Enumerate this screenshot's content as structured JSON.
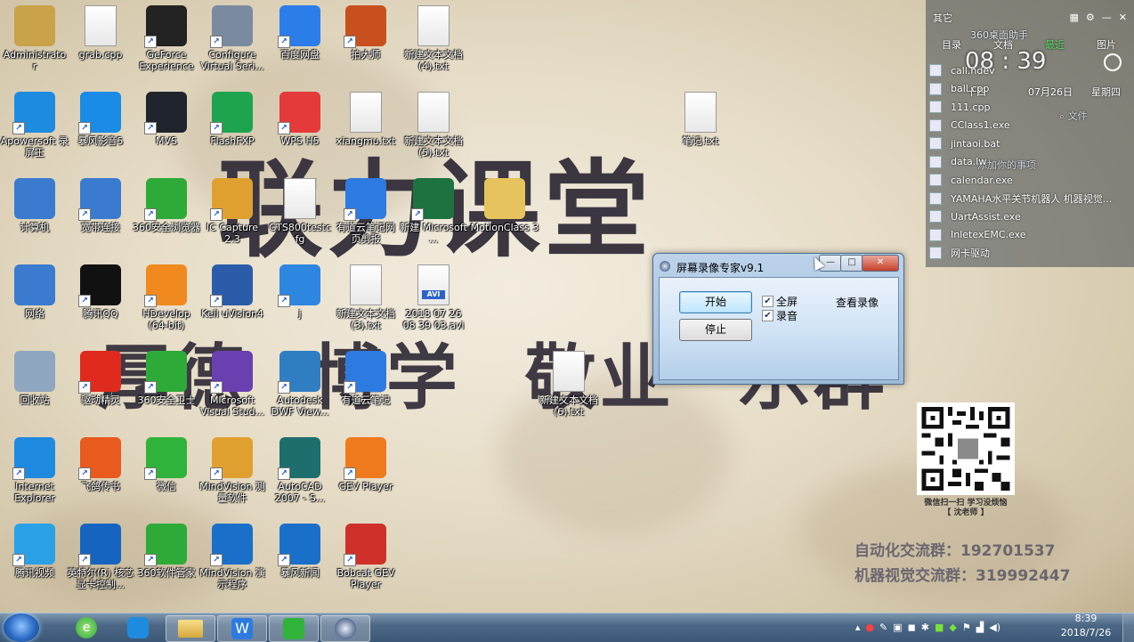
{
  "wallpaper": {
    "title_text": "联力课堂",
    "motto_text": "厚德 博学 敬业 乐群",
    "ad_line1": "自动化交流群：192701537",
    "ad_line2": "机器视觉交流群：319992447",
    "qr_caption_line1": "微信扫一扫 学习没烦恼",
    "qr_caption_line2": "【 沈老师 】"
  },
  "desktop_icons": [
    {
      "label": "Administrato r",
      "icon": "user-folder-icon",
      "color": "#c9a24a"
    },
    {
      "label": "grab.cpp",
      "icon": "cpp-file-icon",
      "color": "#ffffff"
    },
    {
      "label": "GeForce Experience",
      "icon": "nvidia-icon",
      "color": "#222222"
    },
    {
      "label": "Configure Virtual Seri...",
      "icon": "serial-port-icon",
      "color": "#7a8aa0"
    },
    {
      "label": "百度网盘",
      "icon": "cloud-icon",
      "color": "#2b7de9"
    },
    {
      "label": "拍大师",
      "icon": "camera-icon",
      "color": "#c8501e"
    },
    {
      "label": "新建文本文档 (4).txt",
      "icon": "text-file-icon",
      "color": "#ffffff"
    },
    {
      "label": "Apowersoft 录屏王",
      "icon": "apowersoft-icon",
      "color": "#1d8ce0"
    },
    {
      "label": "暴风影音5",
      "icon": "storm-player-icon",
      "color": "#1a8be6"
    },
    {
      "label": "MVS",
      "icon": "mvs-icon",
      "color": "#20252d"
    },
    {
      "label": "FlashFXP",
      "icon": "flashfxp-icon",
      "color": "#1ea44e"
    },
    {
      "label": "WPS H5",
      "icon": "wps-icon",
      "color": "#e43a3a"
    },
    {
      "label": "xiangmu.txt",
      "icon": "text-file-icon",
      "color": "#ffffff"
    },
    {
      "label": "新建文本文档 (5).txt",
      "icon": "text-file-icon",
      "color": "#ffffff"
    },
    {
      "label": "笔记.txt",
      "icon": "text-file-icon",
      "color": "#ffffff"
    },
    {
      "label": "计算机",
      "icon": "computer-icon",
      "color": "#3a7bd0"
    },
    {
      "label": "宽带连接",
      "icon": "network-connection-icon",
      "color": "#3a7bd0"
    },
    {
      "label": "360安全浏览器",
      "icon": "browser-360-icon",
      "color": "#2eaa39"
    },
    {
      "label": "IC Capture 2.3",
      "icon": "ic-capture-icon",
      "color": "#e0a030"
    },
    {
      "label": "GTS800testc fg",
      "icon": "config-file-icon",
      "color": "#ffffff"
    },
    {
      "label": "有道云笔记网 页剪报",
      "icon": "youdao-clip-icon",
      "color": "#2d7be0"
    },
    {
      "label": "新建 Microsoft ...",
      "icon": "excel-icon",
      "color": "#1d7340"
    },
    {
      "label": "MotionClass 3",
      "icon": "folder-icon",
      "color": "#e6c35c"
    },
    {
      "label": "网络",
      "icon": "network-icon",
      "color": "#3a7bd0"
    },
    {
      "label": "腾讯QQ",
      "icon": "qq-icon",
      "color": "#111111"
    },
    {
      "label": "HDevelop (64-bit)",
      "icon": "halcon-icon",
      "color": "#f08a1e"
    },
    {
      "label": "Keil uVision4",
      "icon": "keil-icon",
      "color": "#2a5caa"
    },
    {
      "label": "j",
      "icon": "app-j-icon",
      "color": "#2d86e0"
    },
    {
      "label": "新建文本文档 (3).txt",
      "icon": "text-file-icon",
      "color": "#ffffff"
    },
    {
      "label": "2018 07 26 08 39 03.avi",
      "icon": "avi-file-icon",
      "color": "#ffffff"
    },
    {
      "label": "回收站",
      "icon": "recycle-bin-icon",
      "color": "#8fa7c0"
    },
    {
      "label": "驱动精灵",
      "icon": "driver-genius-icon",
      "color": "#e02a1e"
    },
    {
      "label": "360安全卫士",
      "icon": "security-360-icon",
      "color": "#2eaa39"
    },
    {
      "label": "Microsoft Visual Stud...",
      "icon": "visual-studio-icon",
      "color": "#6a3fb0"
    },
    {
      "label": "Autodesk DWF View...",
      "icon": "autodesk-icon",
      "color": "#2f7ec2"
    },
    {
      "label": "有道云笔记",
      "icon": "youdao-note-icon",
      "color": "#2d7be0"
    },
    {
      "label": "新建文本文档 (6).txt",
      "icon": "text-file-icon",
      "color": "#ffffff"
    },
    {
      "label": "Internet Explorer",
      "icon": "ie-icon",
      "color": "#1e8ae0"
    },
    {
      "label": "飞鸽传书",
      "icon": "feige-icon",
      "color": "#e85a1e"
    },
    {
      "label": "微信",
      "icon": "wechat-icon",
      "color": "#2fb33a"
    },
    {
      "label": "MindVision 测量软件",
      "icon": "mindvision-measure-icon",
      "color": "#e0a030"
    },
    {
      "label": "AutoCAD 2007 - S...",
      "icon": "autocad-icon",
      "color": "#1e6e6e"
    },
    {
      "label": "GEV Player",
      "icon": "gev-icon",
      "color": "#f07a1e"
    },
    {
      "label": "腾讯视频",
      "icon": "tencent-video-icon",
      "color": "#2aa0e6"
    },
    {
      "label": "英特尔(R) 核芯显卡控制...",
      "icon": "intel-icon",
      "color": "#1565c0"
    },
    {
      "label": "360软件管家",
      "icon": "software-manager-icon",
      "color": "#2eaa39"
    },
    {
      "label": "MindVision 演示程序",
      "icon": "mindvision-demo-icon",
      "color": "#1a6fc9"
    },
    {
      "label": "暴风新闻",
      "icon": "news-icon",
      "color": "#1a6fc9"
    },
    {
      "label": "Bobcat GEV Player",
      "icon": "bobcat-icon",
      "color": "#d0302a"
    }
  ],
  "side_panel": {
    "top_label": "其它",
    "tabs": [
      "目录",
      "文档",
      "最近",
      "图片"
    ],
    "helper_text": "360桌面助手",
    "clock": "08 : 39",
    "weekday_cn": "十四",
    "date": "07月26日",
    "weekday": "星期四",
    "files": [
      "call.hdev",
      "ball.cpp",
      "111.cpp",
      "CClass1.exe",
      "jintaoi.bat",
      "data.lw",
      "calendar.exe",
      "YAMAHA水平关节机器人 机器视觉...",
      "UartAssist.exe",
      "InletexEMC.exe",
      "网卡驱动"
    ],
    "search_label": "文件",
    "todo_hint": "添加你的事项"
  },
  "dialog": {
    "title": "屏幕录像专家v9.1",
    "start_label": "开始",
    "stop_label": "停止",
    "fullscreen_label": "全屏",
    "fullscreen_checked": true,
    "audio_label": "录音",
    "audio_checked": true,
    "view_label": "查看录像",
    "minimize_label": "—",
    "maximize_label": "□",
    "close_label": "✕"
  },
  "taskbar": {
    "time": "8:39",
    "date": "2018/7/26",
    "items": [
      "360-browser-task",
      "apowersoft-task",
      "explorer-task",
      "wps-task",
      "iqiyi-task",
      "recorder-task"
    ]
  }
}
